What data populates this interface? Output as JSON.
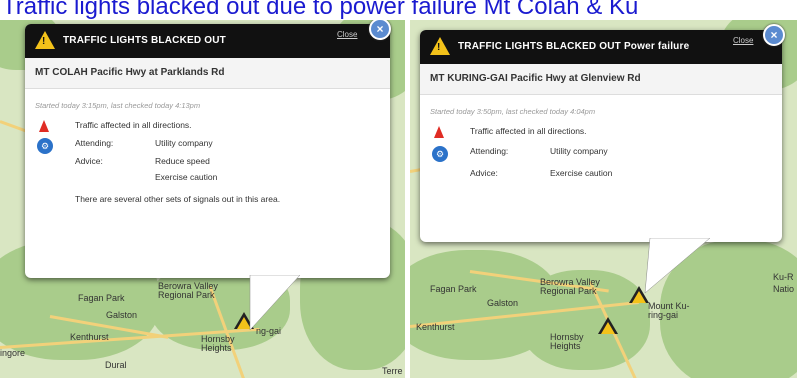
{
  "headline": "Traffic lights blacked out due to power failure Mt Colah & Ku",
  "left": {
    "title": "TRAFFIC LIGHTS BLACKED OUT",
    "close": "Close",
    "location": "MT COLAH Pacific Hwy at Parklands Rd",
    "started": "Started today 3:15pm, last checked today 4:13pm",
    "affected": "Traffic affected in all directions.",
    "attending_label": "Attending:",
    "attending_value": "Utility company",
    "advice_label": "Advice:",
    "advice_value_1": "Reduce speed",
    "advice_value_2": "Exercise caution",
    "note": "There are several other sets of signals out in this area.",
    "map_labels": [
      "Fagan Park",
      "Berowra Valley Regional Park",
      "Galston",
      "Kenthurst",
      "Hornsby Heights",
      "Dural",
      "ingore",
      "Terre",
      "ng-gai"
    ]
  },
  "right": {
    "title": "TRAFFIC LIGHTS BLACKED OUT Power failure",
    "close": "Close",
    "location": "MT KURING-GAI Pacific Hwy at Glenview Rd",
    "started": "Started today 3:50pm, last checked today 4:04pm",
    "affected": "Traffic affected in all directions.",
    "attending_label": "Attending:",
    "attending_value": "Utility company",
    "advice_label": "Advice:",
    "advice_value": "Exercise caution",
    "map_labels": [
      "Fagan Park",
      "Berowra Valley Regional Park",
      "Galston",
      "Kenthurst",
      "Hornsby Heights",
      "Mount Ku-ring-gai",
      "Ku-R",
      "Natio"
    ]
  },
  "colors": {
    "headline": "#1a1ad0",
    "warning": "#f3c21a",
    "header": "#111111",
    "close_x": "#5b8bd0"
  }
}
